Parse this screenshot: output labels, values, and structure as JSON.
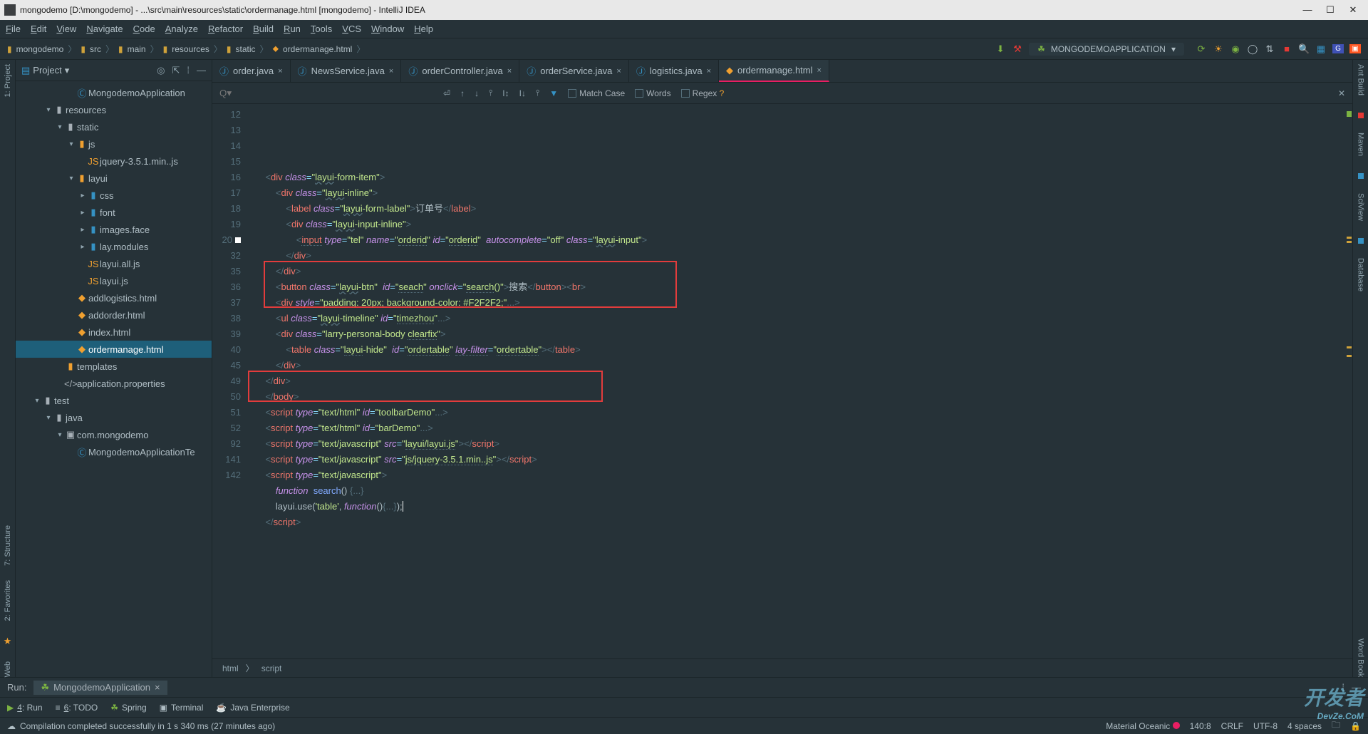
{
  "window": {
    "title": "mongodemo [D:\\mongodemo] - ...\\src\\main\\resources\\static\\ordermanage.html [mongodemo] - IntelliJ IDEA"
  },
  "menu": [
    "File",
    "Edit",
    "View",
    "Navigate",
    "Code",
    "Analyze",
    "Refactor",
    "Build",
    "Run",
    "Tools",
    "VCS",
    "Window",
    "Help"
  ],
  "breadcrumb": [
    "mongodemo",
    "src",
    "main",
    "resources",
    "static",
    "ordermanage.html"
  ],
  "run_config": "MONGODEMOAPPLICATION",
  "sidebar": {
    "title": "Project",
    "tree": [
      {
        "indent": 4,
        "icon": "class",
        "label": "MongodemoApplication",
        "cls": ""
      },
      {
        "indent": 2,
        "icon": "folder",
        "label": "resources",
        "cls": "pink",
        "arrow": "▾"
      },
      {
        "indent": 3,
        "icon": "folder",
        "label": "static",
        "cls": "pink",
        "arrow": "▾"
      },
      {
        "indent": 4,
        "icon": "folder",
        "label": "js",
        "cls": "",
        "arrow": "▾",
        "iconcls": "orange-icon"
      },
      {
        "indent": 5,
        "icon": "js",
        "label": "jquery-3.5.1.min..js",
        "cls": ""
      },
      {
        "indent": 4,
        "icon": "folder",
        "label": "layui",
        "cls": "",
        "arrow": "▾",
        "iconcls": "orange-icon"
      },
      {
        "indent": 5,
        "icon": "folder",
        "label": "css",
        "cls": "",
        "arrow": "▸",
        "iconcls": "blue-icon"
      },
      {
        "indent": 5,
        "icon": "folder",
        "label": "font",
        "cls": "",
        "arrow": "▸",
        "iconcls": "blue-icon"
      },
      {
        "indent": 5,
        "icon": "folder",
        "label": "images.face",
        "cls": "",
        "arrow": "▸",
        "iconcls": "blue-icon"
      },
      {
        "indent": 5,
        "icon": "folder",
        "label": "lay.modules",
        "cls": "",
        "arrow": "▸",
        "iconcls": "blue-icon"
      },
      {
        "indent": 5,
        "icon": "js",
        "label": "layui.all.js",
        "cls": ""
      },
      {
        "indent": 5,
        "icon": "js",
        "label": "layui.js",
        "cls": ""
      },
      {
        "indent": 4,
        "icon": "html",
        "label": "addlogistics.html",
        "cls": ""
      },
      {
        "indent": 4,
        "icon": "html",
        "label": "addorder.html",
        "cls": ""
      },
      {
        "indent": 4,
        "icon": "html",
        "label": "index.html",
        "cls": ""
      },
      {
        "indent": 4,
        "icon": "html",
        "label": "ordermanage.html",
        "cls": "",
        "selected": true
      },
      {
        "indent": 3,
        "icon": "folder",
        "label": "templates",
        "cls": "",
        "iconcls": "orange-icon"
      },
      {
        "indent": 3,
        "icon": "props",
        "label": "application.properties",
        "cls": ""
      },
      {
        "indent": 1,
        "icon": "folder",
        "label": "test",
        "cls": "teal",
        "arrow": "▾"
      },
      {
        "indent": 2,
        "icon": "folder",
        "label": "java",
        "cls": "pink",
        "arrow": "▾"
      },
      {
        "indent": 3,
        "icon": "pkg",
        "label": "com.mongodemo",
        "cls": "pink",
        "arrow": "▾"
      },
      {
        "indent": 4,
        "icon": "class",
        "label": "MongodemoApplicationTe",
        "cls": ""
      }
    ]
  },
  "tabs": [
    {
      "icon": "java",
      "label": "order.java"
    },
    {
      "icon": "java",
      "label": "NewsService.java"
    },
    {
      "icon": "java",
      "label": "orderController.java"
    },
    {
      "icon": "java",
      "label": "orderService.java"
    },
    {
      "icon": "java",
      "label": "logistics.java"
    },
    {
      "icon": "html",
      "label": "ordermanage.html",
      "active": true
    }
  ],
  "findbar": {
    "placeholder": "Q▾",
    "match_case": "Match Case",
    "words": "Words",
    "regex": "Regex"
  },
  "code_lines": [
    {
      "n": "12",
      "html": "    <span class='grey'>&lt;</span><span class='tag'>div</span> <span class='attr'>class</span><span class='eq'>=</span><span class='str'>\"<span class='squig'>layui</span>-form-item\"</span><span class='grey'>&gt;</span>"
    },
    {
      "n": "13",
      "html": "        <span class='grey'>&lt;</span><span class='tag'>div</span> <span class='attr'>class</span><span class='eq'>=</span><span class='str'>\"<span class='squig'>layui</span>-inline\"</span><span class='grey'>&gt;</span>"
    },
    {
      "n": "14",
      "html": "            <span class='grey'>&lt;</span><span class='tag'>label</span> <span class='attr'>class</span><span class='eq'>=</span><span class='str'>\"<span class='squig'>layui</span>-form-label\"</span><span class='grey'>&gt;</span><span class='txt'>订单号</span><span class='grey'>&lt;/</span><span class='tag'>label</span><span class='grey'>&gt;</span>"
    },
    {
      "n": "15",
      "html": "            <span class='grey'>&lt;</span><span class='tag'>div</span> <span class='attr'>class</span><span class='eq'>=</span><span class='str'>\"<span class='squig'>layui</span>-input-inline\"</span><span class='grey'>&gt;</span>"
    },
    {
      "n": "16",
      "html": "                <span class='grey'>&lt;</span><span class='tag uline'>input</span> <span class='attr'>type</span><span class='eq'>=</span><span class='str'>\"tel\"</span> <span class='attr'>name</span><span class='eq'>=</span><span class='str'>\"<span class='uline'>orderid</span>\"</span> <span class='attr'>id</span><span class='eq'>=</span><span class='str'>\"<span class='uline'>orderid</span>\"</span>  <span class='attr'>autocomplete</span><span class='eq'>=</span><span class='str'>\"off\"</span> <span class='attr'>class</span><span class='eq'>=</span><span class='str'>\"<span class='squig'>layui</span>-input\"</span><span class='grey'>&gt;</span>"
    },
    {
      "n": "17",
      "html": "            <span class='grey'>&lt;/</span><span class='tag'>div</span><span class='grey'>&gt;</span>"
    },
    {
      "n": "18",
      "html": "        <span class='grey'>&lt;/</span><span class='tag'>div</span><span class='grey'>&gt;</span>"
    },
    {
      "n": "19",
      "html": "        <span class='grey'>&lt;</span><span class='tag'>button</span> <span class='attr'>class</span><span class='eq'>=</span><span class='str'>\"<span class='squig'>layui</span>-btn\"</span>  <span class='attr'>id</span><span class='eq'>=</span><span class='str'>\"<span class='uline'>seach</span>\"</span> <span class='attr'>onclick</span><span class='eq'>=</span><span class='str'>\"<span class='uline'>search</span>()\"</span><span class='grey'>&gt;</span><span class='txt'>搜索</span><span class='grey'>&lt;/</span><span class='tag'>button</span><span class='grey'>&gt;&lt;</span><span class='tag'>br</span><span class='grey'>&gt;</span>"
    },
    {
      "n": "20",
      "bp": true,
      "html": "        <span class='grey'>&lt;</span><span class='tag'>div</span> <span class='attr'>style</span><span class='eq'>=</span><span class='str'>\"padding: 20px; background-color: #F2F2F2;\"</span><span class='grey'>...&gt;</span>"
    },
    {
      "n": "32",
      "html": "        <span class='grey'>&lt;</span><span class='tag'>ul</span> <span class='attr'>class</span><span class='eq'>=</span><span class='str'>\"<span class='squig'>layui</span>-timeline\"</span> <span class='attr'>id</span><span class='eq'>=</span><span class='str'>\"<span class='uline'>timezhou</span>\"</span><span class='grey'>...&gt;</span>"
    },
    {
      "n": "35",
      "html": "        <span class='grey'>&lt;</span><span class='tag'>div</span> <span class='attr'>class</span><span class='eq'>=</span><span class='str'>\"larry-personal-body <span class='uline'>clearfix</span>\"</span><span class='grey'>&gt;</span>"
    },
    {
      "n": "36",
      "html": "            <span class='grey'>&lt;</span><span class='tag'>table</span> <span class='attr'>class</span><span class='eq'>=</span><span class='str'>\"<span class='uline'>layui</span>-hide\"</span>  <span class='attr'>id</span><span class='eq'>=</span><span class='str'>\"<span class='uline'>ordertable</span>\"</span> <span class='attr uline'>lay-filter</span><span class='eq'>=</span><span class='str'>\"<span class='uline'>ordertable</span>\"</span><span class='grey'>&gt;&lt;/</span><span class='tag'>table</span><span class='grey'>&gt;</span>"
    },
    {
      "n": "37",
      "html": "        <span class='grey'>&lt;/</span><span class='tag'>div</span><span class='grey'>&gt;</span>"
    },
    {
      "n": "38",
      "html": "    <span class='grey'>&lt;/</span><span class='tag'>div</span><span class='grey'>&gt;</span>"
    },
    {
      "n": "39",
      "html": "    <span class='grey'>&lt;/</span><span class='tag'>body</span><span class='grey'>&gt;</span>"
    },
    {
      "n": "40",
      "html": "    <span class='grey'>&lt;</span><span class='tag'>script</span> <span class='attr'>type</span><span class='eq'>=</span><span class='str'>\"text/html\"</span> <span class='attr'>id</span><span class='eq'>=</span><span class='str'>\"toolbarDemo\"</span><span class='grey'>...&gt;</span>"
    },
    {
      "n": "45",
      "html": "    <span class='grey'>&lt;</span><span class='tag'>script</span> <span class='attr'>type</span><span class='eq'>=</span><span class='str'>\"text/html\"</span> <span class='attr'>id</span><span class='eq'>=</span><span class='str'>\"barDemo\"</span><span class='grey'>...&gt;</span>"
    },
    {
      "n": "49",
      "html": "    <span class='grey'>&lt;</span><span class='tag'>script</span> <span class='attr'>type</span><span class='eq'>=</span><span class='str'>\"text/javascript\"</span> <span class='attr'>src</span><span class='eq'>=</span><span class='str'>\"<span class='uline'>layui/layui.js</span>\"</span><span class='grey'>&gt;&lt;/</span><span class='tag'>script</span><span class='grey'>&gt;</span>"
    },
    {
      "n": "50",
      "html": "    <span class='grey'>&lt;</span><span class='tag'>script</span> <span class='attr'>type</span><span class='eq'>=</span><span class='str'>\"text/javascript\"</span> <span class='attr'>src</span><span class='eq'>=</span><span class='str'>\"<span class='uline'>js/jquery-3.5.1.min..js</span>\"</span><span class='grey'>&gt;&lt;/</span><span class='tag'>script</span><span class='grey'>&gt;</span>"
    },
    {
      "n": "51",
      "html": "    <span class='grey'>&lt;</span><span class='tag'>script</span> <span class='attr'>type</span><span class='eq'>=</span><span class='str'>\"text/javascript\"</span><span class='grey'>&gt;</span>"
    },
    {
      "n": "52",
      "html": "        <span class='kw'>function</span>  <span class='fn'>search</span>() <span class='grey'>{...}</span>"
    },
    {
      "n": "92",
      "html": "        layui.use(<span class='str'>'table'</span>, <span class='kw'>function</span>()<span class='grey'>{...}</span>);<span style='border-left:1px solid #fff;'>&nbsp;</span>"
    },
    {
      "n": "141",
      "html": "    <span class='grey'>&lt;/</span><span class='tag'>script</span><span class='grey'>&gt;</span>"
    },
    {
      "n": "142",
      "html": ""
    }
  ],
  "editor_breadcrumb": [
    "html",
    "script"
  ],
  "run": {
    "title": "Run:",
    "tab": "MongodemoApplication"
  },
  "bottom_tools": [
    {
      "icon": "▶",
      "label": "4: Run",
      "u": "4"
    },
    {
      "icon": "≡",
      "label": "6: TODO",
      "u": "6"
    },
    {
      "icon": "leaf",
      "label": "Spring"
    },
    {
      "icon": "term",
      "label": "Terminal"
    },
    {
      "icon": "java",
      "label": "Java Enterprise"
    }
  ],
  "status": {
    "msg": "Compilation completed successfully in 1 s 340 ms (27 minutes ago)",
    "theme": "Material Oceanic",
    "pos": "140:8",
    "eol": "CRLF",
    "enc": "UTF-8",
    "indent": "4 spaces"
  },
  "left_tools": [
    "1: Project"
  ],
  "left_tools2": [
    "2: Favorites",
    "7: Structure"
  ],
  "left_tools3": [
    "Web"
  ],
  "right_tools": [
    "Ant Build",
    "Maven",
    "SciView",
    "Database",
    "Word Book"
  ],
  "watermark": {
    "big": "开发者",
    "small": "DevZe.CoM"
  }
}
